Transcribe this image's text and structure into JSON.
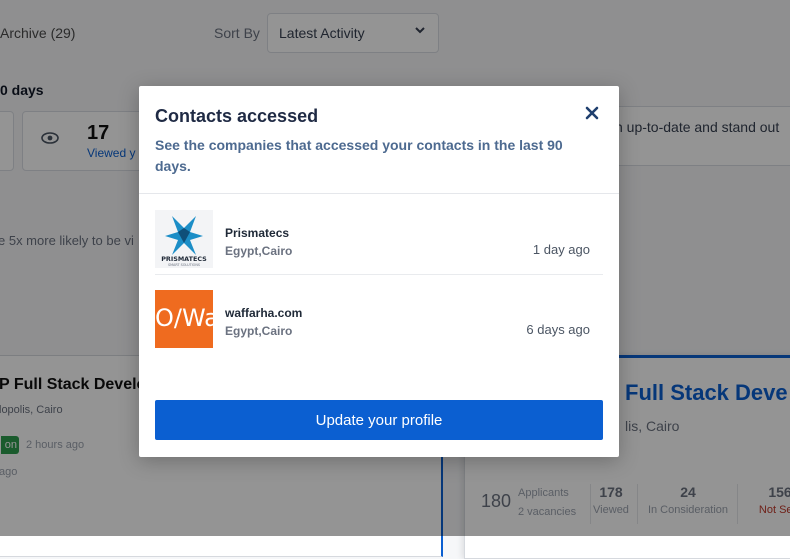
{
  "background": {
    "archive_tab": "Archive (29)",
    "sort_label": "Sort By",
    "sort_value": "Latest Activity",
    "period_label": "0 days",
    "stat_views_number": "17",
    "stat_views_label": "Viewed y",
    "tip_text": "n up-to-date and stand out",
    "more_likely_text": "e 5x more likely to be vi",
    "left_card": {
      "title": "P Full Stack Develop",
      "location": "lopolis, Cairo",
      "badge": "on",
      "time": "2 hours ago",
      "ago": "ago"
    },
    "right_card": {
      "title": "Full Stack Deve",
      "location": "lis, Cairo",
      "applicants_total": "180",
      "applicants_label": "Applicants",
      "vacancies_label": "2 vacancies",
      "viewed_count": "178",
      "viewed_label": "Viewed",
      "consideration_count": "24",
      "consideration_label": "In Consideration",
      "not_selected_count": "156",
      "not_selected_label": "Not Sele"
    }
  },
  "modal": {
    "title": "Contacts accessed",
    "close_icon": "close-icon",
    "description": "See the companies that accessed your contacts in the last 90 days.",
    "companies": [
      {
        "name": "Prismatecs",
        "location": "Egypt,Cairo",
        "accessed": "1 day ago",
        "logo_text": "PRISMATECS",
        "logo_sub": "SMART SOLUTIONS"
      },
      {
        "name": "waffarha.com",
        "location": "Egypt,Cairo",
        "accessed": "6 days ago",
        "logo_text": "O/Wa"
      }
    ],
    "cta_label": "Update your profile"
  },
  "colors": {
    "primary": "#0b5fd1",
    "waffarha_brand": "#ef6b1f",
    "title": "#1f2a44",
    "description": "#4d6a90"
  }
}
